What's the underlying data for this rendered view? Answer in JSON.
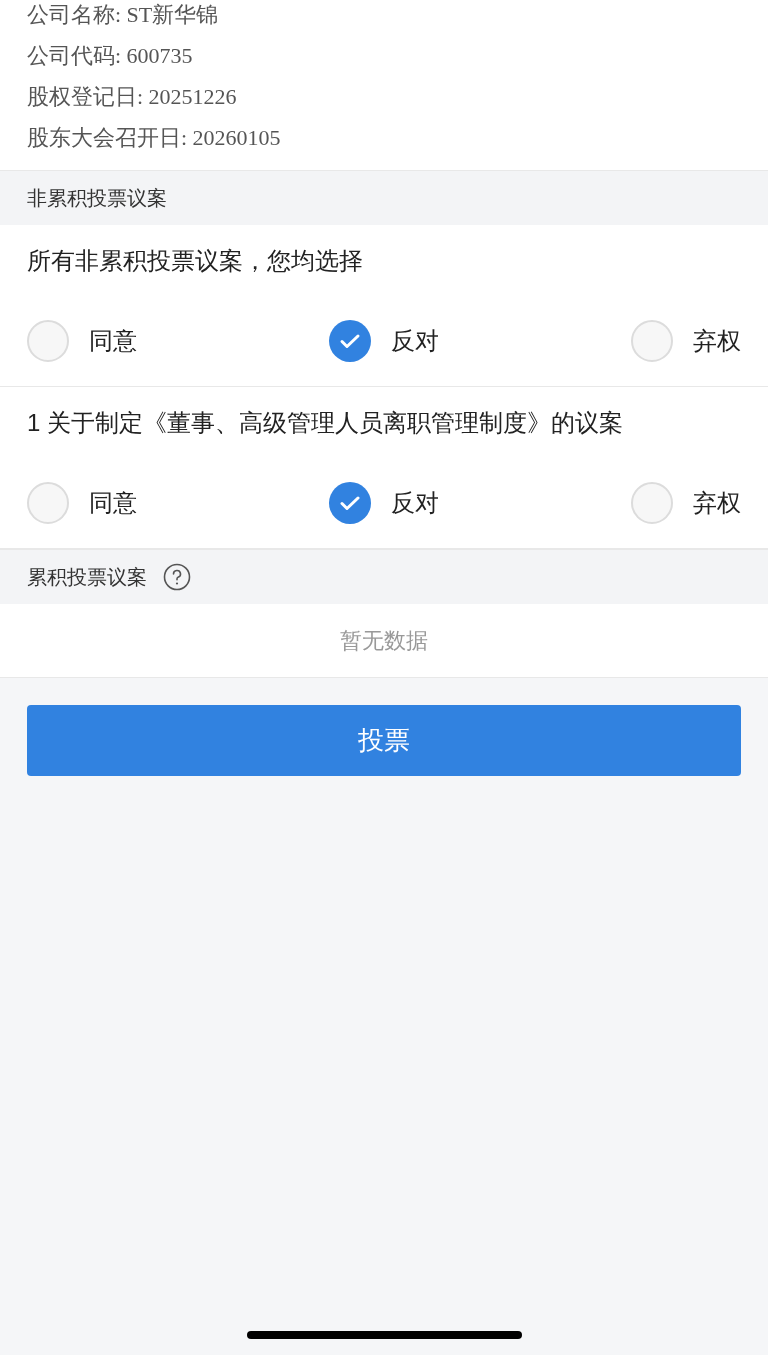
{
  "info": [
    "公司名称: ST新华锦",
    "公司代码: 600735",
    "股权登记日: 20251226",
    "股东大会召开日: 20260105"
  ],
  "non_cumulative": {
    "title": "非累积投票议案",
    "items": [
      {
        "text": "所有非累积投票议案，您均选择",
        "options": [
          {
            "label": "同意",
            "selected": false
          },
          {
            "label": "反对",
            "selected": true
          },
          {
            "label": "弃权",
            "selected": false
          }
        ]
      },
      {
        "text": "1 关于制定《董事、高级管理人员离职管理制度》的议案",
        "options": [
          {
            "label": "同意",
            "selected": false
          },
          {
            "label": "反对",
            "selected": true
          },
          {
            "label": "弃权",
            "selected": false
          }
        ]
      }
    ]
  },
  "cumulative": {
    "title": "累积投票议案",
    "empty": "暂无数据"
  },
  "submit": "投票"
}
